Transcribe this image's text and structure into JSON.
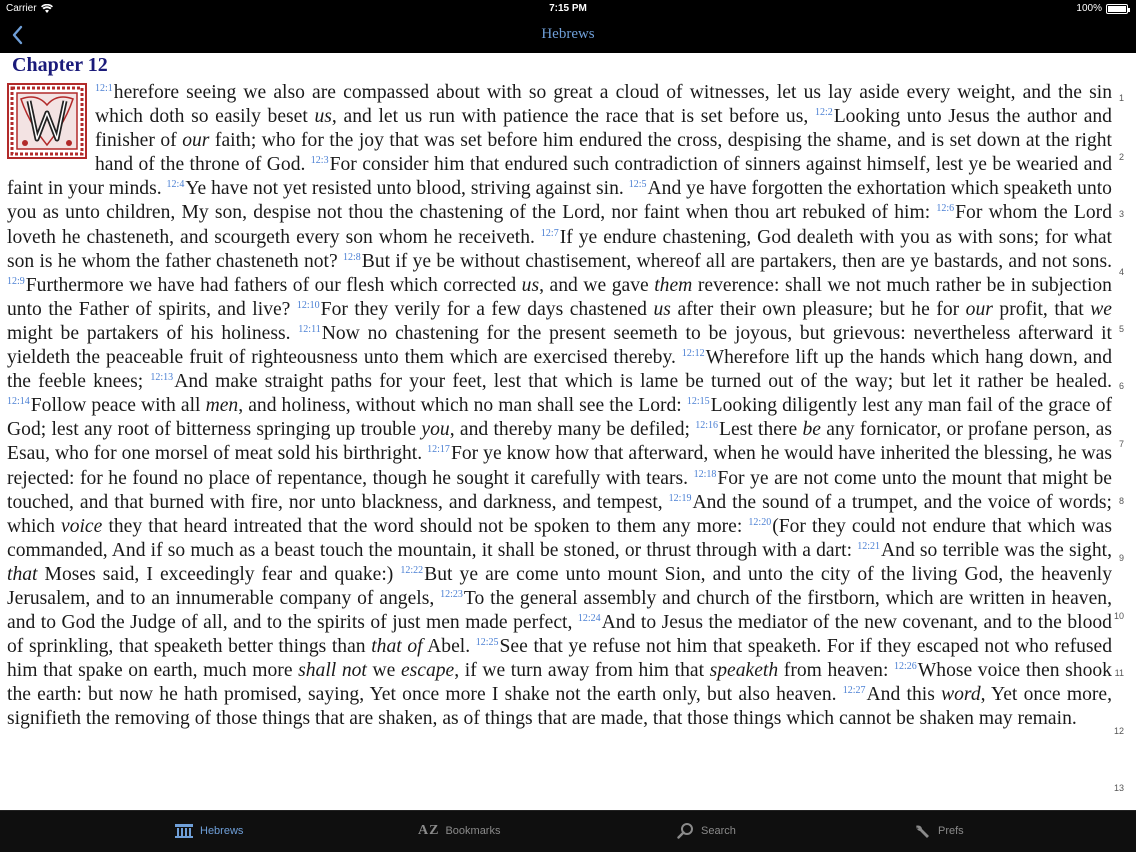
{
  "status_bar": {
    "carrier": "Carrier",
    "time": "7:15 PM",
    "battery": "100%",
    "battery_level": 1.0
  },
  "nav": {
    "title": "Hebrews",
    "back_icon": "chevron-left-icon"
  },
  "chapter": {
    "heading": "Chapter 12",
    "dropcap_icon": "illuminated-letter-w-icon"
  },
  "verses": [
    {
      "ref": "12:1",
      "html": "herefore seeing we also are compassed about with so great a cloud of witnesses, let us lay aside every weight, and the sin which doth so easily beset <i>us</i>, and let us run with patience the race that is set before us, "
    },
    {
      "ref": "12:2",
      "html": "Looking unto Jesus the author and finisher of <i>our</i> faith; who for the joy that was set before him endured the cross, despising the shame, and is set down at the right hand of the throne of God. "
    },
    {
      "ref": "12:3",
      "html": "For consider him that endured such contradiction of sinners against himself, lest ye be wearied and faint in your minds. "
    },
    {
      "ref": "12:4",
      "html": "Ye have not yet resisted unto blood, striving against sin. "
    },
    {
      "ref": "12:5",
      "html": "And ye have forgotten the exhortation which speaketh unto you as unto children, My son, despise not thou the chastening of the Lord, nor faint when thou art rebuked of him: "
    },
    {
      "ref": "12:6",
      "html": "For whom the Lord loveth he chasteneth, and scourgeth every son whom he receiveth. "
    },
    {
      "ref": "12:7",
      "html": "If ye endure chastening, God dealeth with you as with sons; for what son is he whom the father chasteneth not? "
    },
    {
      "ref": "12:8",
      "html": "But if ye be without chastisement, whereof all are partakers, then are ye bastards, and not sons. "
    },
    {
      "ref": "12:9",
      "html": "Furthermore we have had fathers of our flesh which corrected <i>us</i>, and we gave <i>them</i> reverence: shall we not much rather be in subjection unto the Father of spirits, and live? "
    },
    {
      "ref": "12:10",
      "html": "For they verily for a few days chastened <i>us</i> after their own pleasure; but he for <i>our</i> profit, that <i>we</i> might be partakers of his holiness. "
    },
    {
      "ref": "12:11",
      "html": "Now no chastening for the present seemeth to be joyous, but grievous: nevertheless afterward it yieldeth the peaceable fruit of righteousness unto them which are exercised thereby. "
    },
    {
      "ref": "12:12",
      "html": "Wherefore lift up the hands which hang down, and the feeble knees; "
    },
    {
      "ref": "12:13",
      "html": "And make straight paths for your feet, lest that which is lame be turned out of the way; but let it rather be healed. "
    },
    {
      "ref": "12:14",
      "html": "Follow peace with all <i>men</i>, and holiness, without which no man shall see the Lord: "
    },
    {
      "ref": "12:15",
      "html": "Looking diligently lest any man fail of the grace of God; lest any root of bitterness springing up trouble <i>you</i>, and thereby many be defiled; "
    },
    {
      "ref": "12:16",
      "html": "Lest there <i>be</i> any fornicator, or profane person, as Esau, who for one morsel of meat sold his birthright. "
    },
    {
      "ref": "12:17",
      "html": "For ye know how that afterward, when he would have inherited the blessing, he was rejected: for he found no place of repentance, though he sought it carefully with tears. "
    },
    {
      "ref": "12:18",
      "html": "For ye are not come unto the mount that might be touched, and that burned with fire, nor unto blackness, and darkness, and tempest, "
    },
    {
      "ref": "12:19",
      "html": "And the sound of a trumpet, and the voice of words; which <i>voice</i> they that heard intreated that the word should not be spoken to them any more: "
    },
    {
      "ref": "12:20",
      "html": "(For they could not endure that which was commanded, And if so much as a beast touch the mountain, it shall be stoned, or thrust through with a dart: "
    },
    {
      "ref": "12:21",
      "html": "And so terrible was the sight, <i>that</i> Moses said, I exceedingly fear and quake:) "
    },
    {
      "ref": "12:22",
      "html": "But ye are come unto mount Sion, and unto the city of the living God, the heavenly Jerusalem, and to an innumerable company of angels, "
    },
    {
      "ref": "12:23",
      "html": "To the general assembly and church of the firstborn, which are written in heaven, and to God the Judge of all, and to the spirits of just men made perfect, "
    },
    {
      "ref": "12:24",
      "html": "And to Jesus the mediator of the new covenant, and to the blood of sprinkling, that speaketh better things than <i>that of</i> Abel. "
    },
    {
      "ref": "12:25",
      "html": "See that ye refuse not him that speaketh. For if they escaped not who refused him that spake on earth, much more <i>shall not</i> we <i>escape</i>, if we turn away from him that <i>speaketh</i> from heaven: "
    },
    {
      "ref": "12:26",
      "html": "Whose voice then shook the earth: but now he hath promised, saying, Yet once more I shake not the earth only, but also heaven. "
    },
    {
      "ref": "12:27",
      "html": "And this <i>word</i>, Yet once more, signifieth the removing of those things that are shaken, as of things that are made, that those things which cannot be shaken may remain. "
    }
  ],
  "margin_line_numbers": [
    "1",
    "2",
    "3",
    "4",
    "5",
    "6",
    "7",
    "8",
    "9",
    "10",
    "11",
    "12",
    "13"
  ],
  "tabs": [
    {
      "label": "Hebrews",
      "icon": "book-icon",
      "active": true
    },
    {
      "label": "Bookmarks",
      "icon": "az-icon",
      "active": false
    },
    {
      "label": "Search",
      "icon": "search-icon",
      "active": false
    },
    {
      "label": "Prefs",
      "icon": "wrench-icon",
      "active": false
    }
  ],
  "colors": {
    "accent": "#6f9fd8",
    "verse_number": "#4a7fd3",
    "heading": "#1a1a7a",
    "dropcap_red": "#b22a2a"
  }
}
